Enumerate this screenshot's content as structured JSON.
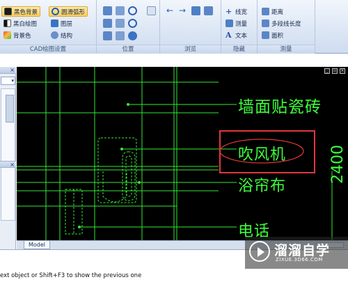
{
  "ribbon": {
    "cad_settings": {
      "label": "CAD绘图设置",
      "black_background": "黑色背景",
      "smooth_arc": "圆滑弧形",
      "black_white": "黑白绘图",
      "layers": "图层",
      "background_color": "背景色",
      "structure": "结构"
    },
    "position": {
      "label": "位置"
    },
    "browse": {
      "label": "浏览"
    },
    "hide": {
      "label": "隐藏",
      "line_width": "线宽",
      "measure": "测量",
      "text": "文本"
    },
    "measure_group": {
      "label": "测量",
      "distance": "距离",
      "polyline_length": "多段线长度",
      "area": "面积"
    }
  },
  "drawing": {
    "labels": {
      "wall_tile": "墙面贴瓷砖",
      "hair_dryer": "吹风机",
      "shower_curtain": "浴帘布",
      "telephone": "电话",
      "dimension": "2400"
    },
    "highlight_color": "#e0383e",
    "line_color": "#3cff3c"
  },
  "tabs": {
    "model": "Model"
  },
  "command_line": {
    "text": "ext object or Shift+F3 to show the previous one"
  },
  "watermark": {
    "title": "溜溜自学",
    "subtitle": "ZIXUE.3D66.COM"
  }
}
